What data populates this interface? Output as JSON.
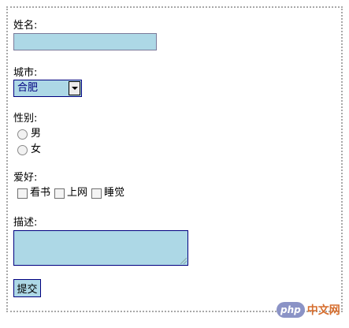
{
  "form": {
    "name_label": "姓名:",
    "name_value": "",
    "city_label": "城市:",
    "city_selected": "合肥",
    "gender_label": "性别:",
    "gender_options": [
      "男",
      "女"
    ],
    "hobby_label": "爱好:",
    "hobby_options": [
      "看书",
      "上网",
      "睡觉"
    ],
    "desc_label": "描述:",
    "desc_value": "",
    "submit_label": "提交"
  },
  "watermark": {
    "badge": "php",
    "text": "中文网"
  },
  "colors": {
    "field_bg": "#add8e6",
    "field_border": "#000080",
    "frame_border": "#a8a8a8"
  }
}
